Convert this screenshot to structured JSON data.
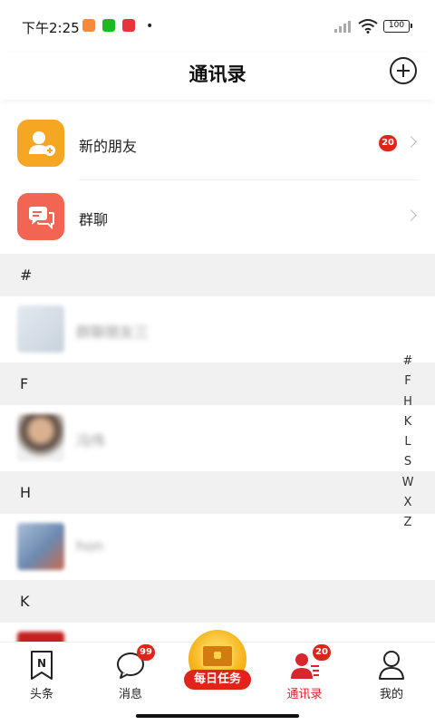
{
  "status_bar": {
    "time": "下午2:25",
    "battery": "100"
  },
  "header": {
    "title": "通讯录"
  },
  "top_rows": [
    {
      "label": "新的朋友",
      "badge": "20",
      "icon": "add-friend-icon",
      "color": "#f5a623"
    },
    {
      "label": "群聊",
      "icon": "group-chat-icon",
      "color": "#f26553"
    }
  ],
  "sections": [
    {
      "letter": "#",
      "contacts": [
        {
          "name": "群聊朋友三",
          "avatar_color": "#d8e1ea"
        }
      ]
    },
    {
      "letter": "F",
      "contacts": [
        {
          "name": "冯伟",
          "avatar_color": "#c9a487"
        }
      ]
    },
    {
      "letter": "H",
      "contacts": [
        {
          "name": "hon",
          "avatar_color": "#8ea6c7"
        }
      ]
    },
    {
      "letter": "K",
      "contacts": []
    }
  ],
  "index_letters": [
    "#",
    "F",
    "H",
    "K",
    "L",
    "S",
    "W",
    "X",
    "Z"
  ],
  "bottom_nav": {
    "items": [
      {
        "label": "头条",
        "icon": "news-icon"
      },
      {
        "label": "消息",
        "icon": "message-icon",
        "badge": "99"
      },
      {
        "label": "每日任务",
        "icon": "treasure-chest-icon"
      },
      {
        "label": "通讯录",
        "icon": "contacts-icon",
        "badge": "20",
        "active": true
      },
      {
        "label": "我的",
        "icon": "profile-icon"
      }
    ]
  },
  "colors": {
    "accent": "#d9252c",
    "badge": "#e0241a"
  }
}
